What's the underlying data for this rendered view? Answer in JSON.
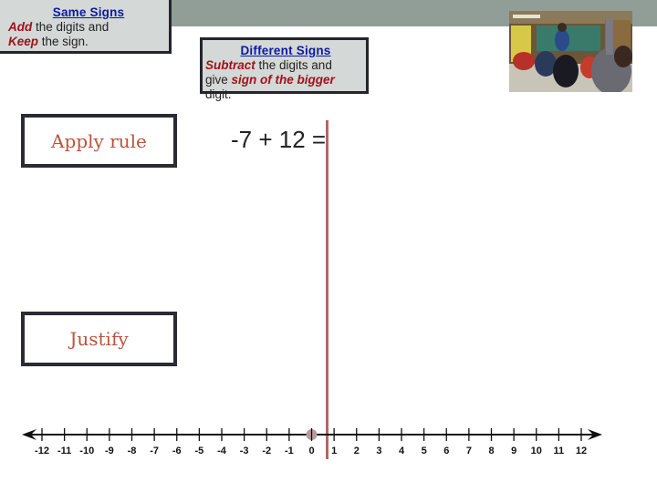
{
  "rules": {
    "same_signs": {
      "title": "Same Signs",
      "line1_bold": "Add",
      "line1_rest": " the digits and",
      "line2_bold": "Keep",
      "line2_rest": " the sign."
    },
    "different_signs": {
      "title": "Different Signs",
      "line1_bold": "Subtract",
      "line1_rest": " the digits and",
      "line2_start": "give ",
      "line2_bold": "sign of the bigger",
      "line3": "digit."
    }
  },
  "steps": {
    "apply_rule": "Apply rule",
    "justify": "Justify"
  },
  "problem": {
    "equation": "-7 + 12 ="
  },
  "number_line": {
    "min": -12,
    "max": 12,
    "step": 1,
    "marked_point": 0,
    "vertical_marker_at": 0.7
  },
  "colors": {
    "header_band": "#909e97",
    "rule_title": "#0b1ba0",
    "rule_emphasis": "#a0121a",
    "step_text": "#b8543e",
    "marker_line": "#b06a5e",
    "point": "#b99ba0"
  },
  "image": {
    "description": "classroom-photo"
  }
}
